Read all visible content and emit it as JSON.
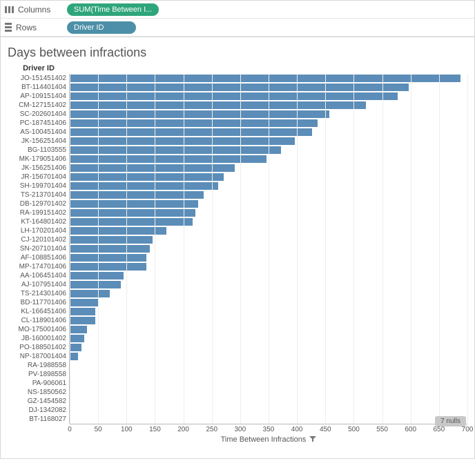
{
  "shelves": {
    "columns_label": "Columns",
    "rows_label": "Rows",
    "columns_pill": "SUM(Time Between I...",
    "rows_pill": "Driver ID"
  },
  "chart_title": "Days between infractions",
  "y_axis_title": "Driver ID",
  "x_axis_title": "Time Between Infractions",
  "nulls_badge": "7 nulls",
  "chart_data": {
    "type": "bar",
    "orientation": "horizontal",
    "xlabel": "Time Between Infractions",
    "ylabel": "Driver ID",
    "xlim": [
      0,
      700
    ],
    "x_ticks": [
      0,
      50,
      100,
      150,
      200,
      250,
      300,
      350,
      400,
      450,
      500,
      550,
      600,
      650,
      700
    ],
    "categories": [
      "JO-151451402",
      "BT-114401404",
      "AP-109151404",
      "CM-127151402",
      "SC-202601404",
      "PC-187451406",
      "AS-100451404",
      "JK-156251404",
      "BG-1103555",
      "MK-179051406",
      "JK-156251406",
      "JR-156701404",
      "SH-199701404",
      "TS-213701404",
      "DB-129701402",
      "RA-199151402",
      "KT-164801402",
      "LH-170201404",
      "CJ-120101402",
      "SN-207101404",
      "AF-108851406",
      "MP-174701406",
      "AA-106451404",
      "AJ-107951404",
      "TS-214301406",
      "BD-117701406",
      "KL-166451406",
      "CL-118901406",
      "MO-175001406",
      "JB-160001402",
      "PO-188501402",
      "NP-187001404",
      "RA-1988558",
      "PV-1898558",
      "PA-906061",
      "NS-1850562",
      "GZ-1454582",
      "DJ-1342082",
      "BT-1168027"
    ],
    "values": [
      685,
      595,
      575,
      520,
      455,
      435,
      425,
      395,
      370,
      345,
      290,
      270,
      260,
      235,
      225,
      220,
      215,
      170,
      145,
      140,
      135,
      135,
      95,
      90,
      70,
      50,
      45,
      45,
      30,
      25,
      20,
      15,
      0,
      0,
      0,
      0,
      0,
      0,
      0
    ]
  }
}
